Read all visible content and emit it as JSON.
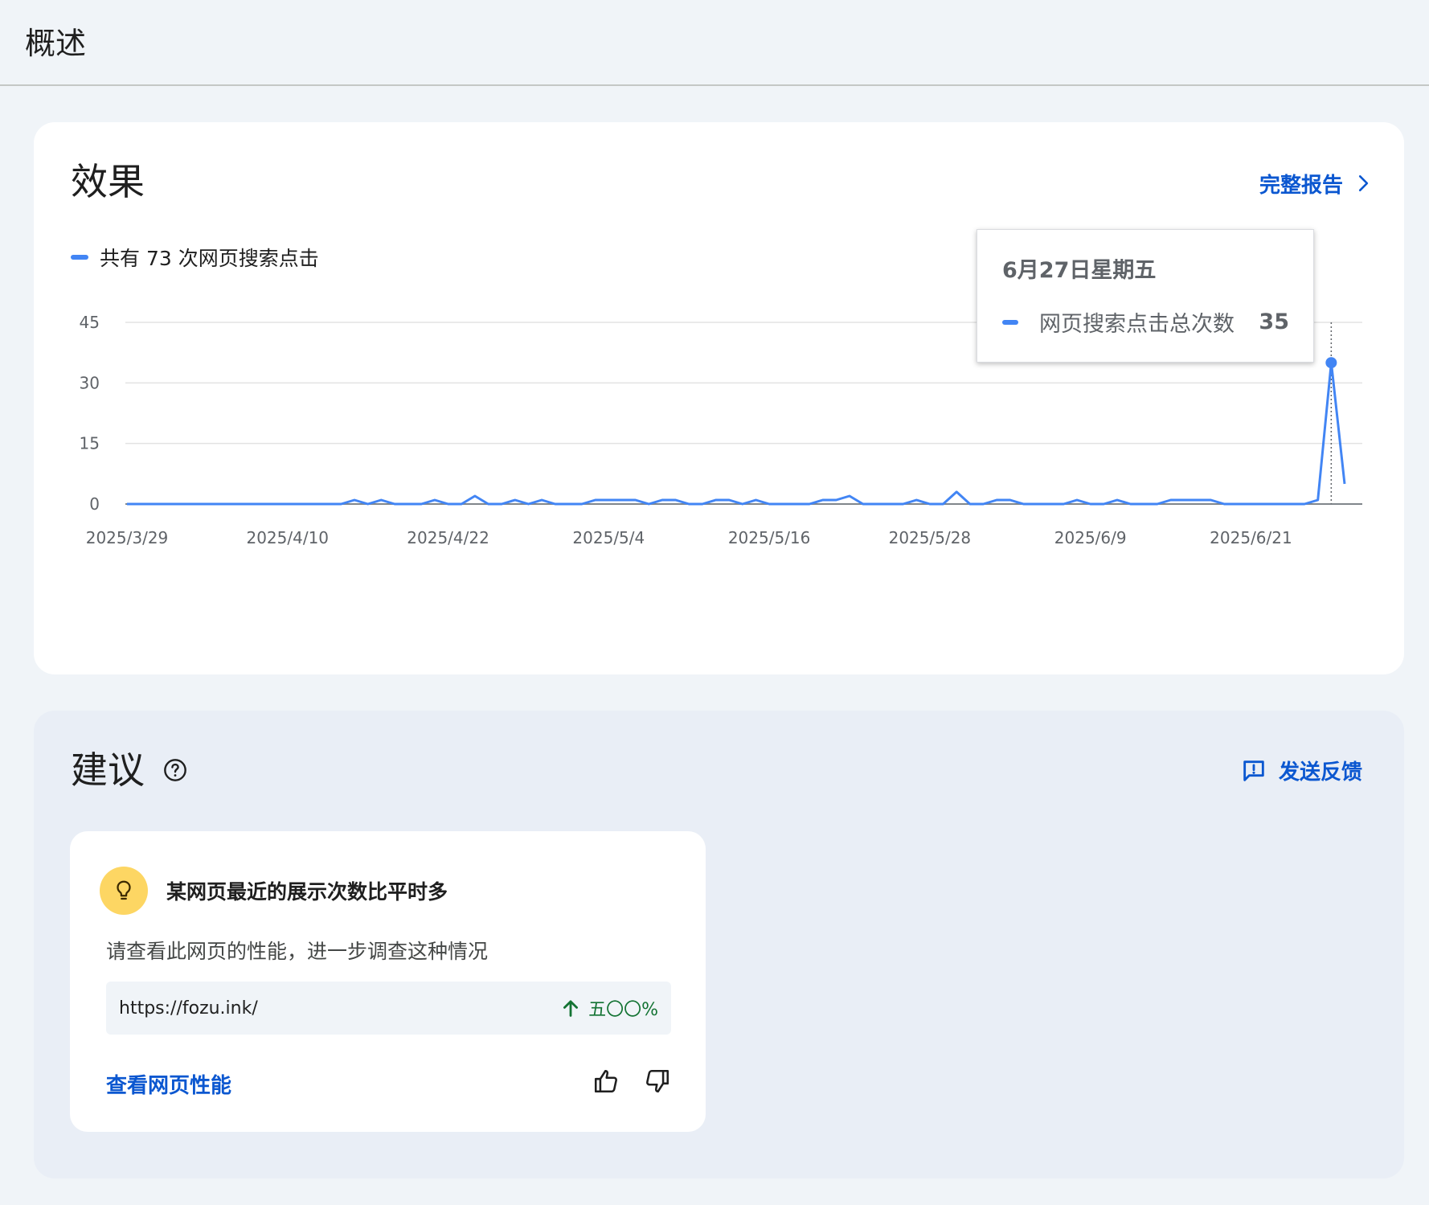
{
  "header": {
    "title": "概述"
  },
  "performance": {
    "title": "效果",
    "full_report_label": "完整报告",
    "legend_label": "共有 73 次网页搜索点击",
    "series_color": "#4285f4",
    "tooltip": {
      "date": "6月27日星期五",
      "metric_label": "网页搜索点击总次数",
      "value": "35"
    }
  },
  "chart_data": {
    "type": "line",
    "series": [
      {
        "name": "网页搜索点击总次数",
        "values": [
          0,
          0,
          0,
          0,
          0,
          0,
          0,
          0,
          0,
          0,
          0,
          0,
          0,
          0,
          0,
          0,
          0,
          1,
          0,
          1,
          0,
          0,
          0,
          1,
          0,
          0,
          2,
          0,
          0,
          1,
          0,
          1,
          0,
          0,
          0,
          1,
          1,
          1,
          1,
          0,
          1,
          1,
          0,
          0,
          1,
          1,
          0,
          1,
          0,
          0,
          0,
          0,
          1,
          1,
          2,
          0,
          0,
          0,
          0,
          1,
          0,
          0,
          3,
          0,
          0,
          1,
          1,
          0,
          0,
          0,
          0,
          1,
          0,
          0,
          1,
          0,
          0,
          0,
          1,
          1,
          1,
          1,
          0,
          0,
          0,
          0,
          0,
          0,
          0,
          1,
          35,
          5
        ]
      }
    ],
    "x_tick_labels": [
      "2025/3/29",
      "2025/4/10",
      "2025/4/22",
      "2025/5/4",
      "2025/5/16",
      "2025/5/28",
      "2025/6/9",
      "2025/6/21"
    ],
    "y_ticks": [
      0,
      15,
      30,
      45
    ],
    "ylim": [
      0,
      45
    ],
    "grid": true,
    "highlight_index": 90
  },
  "suggestions": {
    "title": "建议",
    "feedback_label": "发送反馈",
    "card": {
      "heading": "某网页最近的展示次数比平时多",
      "description": "请查看此网页的性能，进一步调查这种情况",
      "url": "https://fozu.ink/",
      "change": "五〇〇%",
      "change_color": "#137333",
      "action_label": "查看网页性能"
    }
  }
}
